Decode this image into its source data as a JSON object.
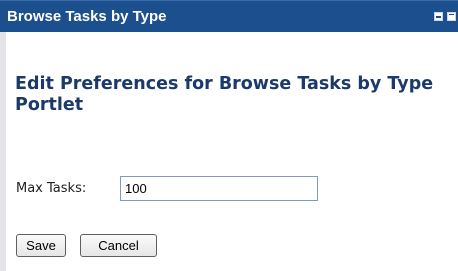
{
  "portlet": {
    "title": "Browse Tasks by Type",
    "controls": {
      "minimize_icon": "minimize-icon",
      "maximize_icon": "maximize-icon"
    }
  },
  "main": {
    "heading": "Edit Preferences for Browse Tasks by Type Portlet",
    "max_tasks": {
      "label": "Max Tasks:",
      "value": "100"
    },
    "buttons": {
      "save": "Save",
      "cancel": "Cancel"
    }
  },
  "colors": {
    "titlebar_bg": "#1b4f8e",
    "heading_text": "#1b3a6b"
  }
}
